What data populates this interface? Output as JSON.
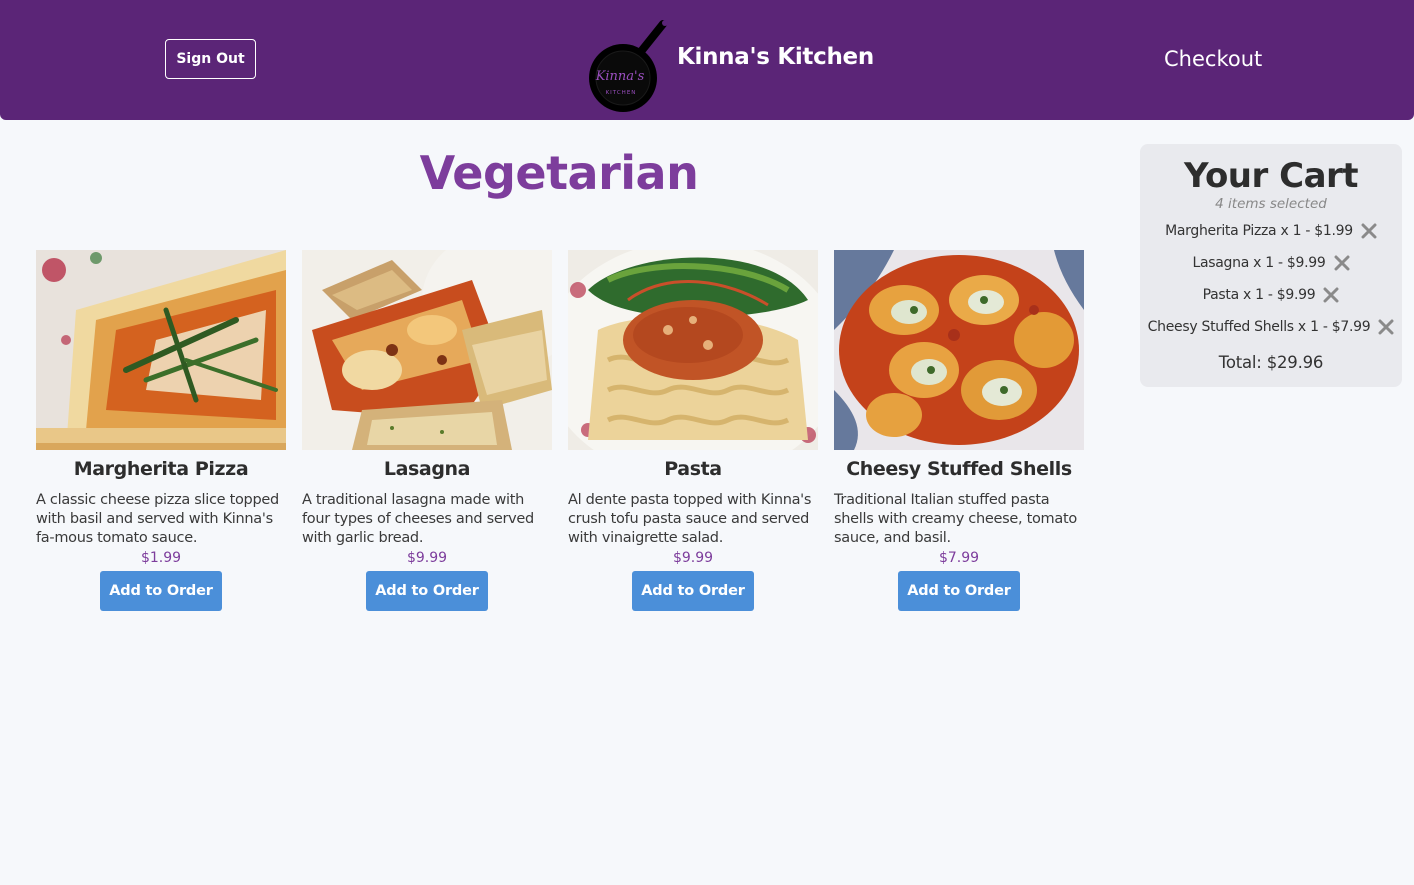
{
  "header": {
    "signout_label": "Sign Out",
    "brand": "Kinna's Kitchen",
    "checkout_label": "Checkout",
    "logo_text": "Kinna's Kitchen",
    "colors": {
      "bar": "#5b2577"
    }
  },
  "category": {
    "title": "Vegetarian"
  },
  "menu": {
    "items": [
      {
        "name": "Margherita Pizza",
        "description": "A classic cheese pizza slice topped with basil and served with Kinna's fa-mous tomato sauce.",
        "price": "$1.99",
        "button": "Add to Order",
        "image": "pizza-photo"
      },
      {
        "name": "Lasagna",
        "description": "A traditional lasagna made with four types of cheeses and served with garlic bread.",
        "price": "$9.99",
        "button": "Add to Order",
        "image": "lasagna-photo"
      },
      {
        "name": "Pasta",
        "description": "Al dente pasta topped with Kinna's crush tofu pasta sauce and served with vinaigrette salad.",
        "price": "$9.99",
        "button": "Add to Order",
        "image": "pasta-photo"
      },
      {
        "name": "Cheesy Stuffed Shells",
        "description": "Traditional Italian stuffed pasta shells with creamy cheese, tomato sauce, and basil.",
        "price": "$7.99",
        "button": "Add to Order",
        "image": "shells-photo"
      }
    ]
  },
  "cart": {
    "title": "Your Cart",
    "count_text": "4 items selected",
    "items": [
      {
        "text": "Margherita Pizza x 1 - $1.99",
        "icon": "close-icon"
      },
      {
        "text": "Lasagna x 1 - $9.99",
        "icon": "close-icon"
      },
      {
        "text": "Pasta x 1 - $9.99",
        "icon": "close-icon"
      },
      {
        "text": "Cheesy Stuffed Shells x 1 - $7.99",
        "icon": "close-icon"
      }
    ],
    "total_text": "Total: $29.96"
  },
  "colors": {
    "accent_purple": "#7d3d9c",
    "button_blue": "#4b8fd9",
    "background": "#f6f8fb",
    "cart_bg": "#e9eaee"
  }
}
